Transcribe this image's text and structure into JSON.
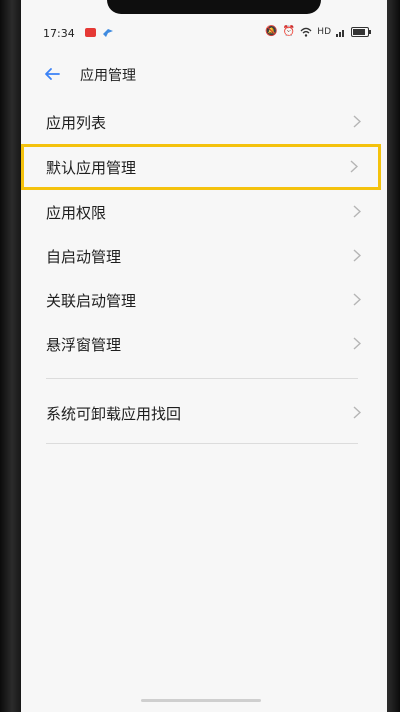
{
  "status_bar": {
    "time": "17:34",
    "network_label": "HD"
  },
  "header": {
    "title": "应用管理"
  },
  "menu": {
    "items": [
      {
        "label": "应用列表"
      },
      {
        "label": "默认应用管理",
        "highlighted": true
      },
      {
        "label": "应用权限"
      },
      {
        "label": "自启动管理"
      },
      {
        "label": "关联启动管理"
      },
      {
        "label": "悬浮窗管理"
      }
    ],
    "secondary_items": [
      {
        "label": "系统可卸载应用找回"
      }
    ]
  },
  "colors": {
    "highlight_border": "#f4c20d",
    "accent_back_arrow": "#3b82f6",
    "screen_background": "#f7f7f7"
  },
  "icons": [
    "back-arrow-icon",
    "chevron-right-icon",
    "battery-icon",
    "wifi-icon",
    "alarm-icon",
    "mute-icon",
    "signal-icon"
  ]
}
